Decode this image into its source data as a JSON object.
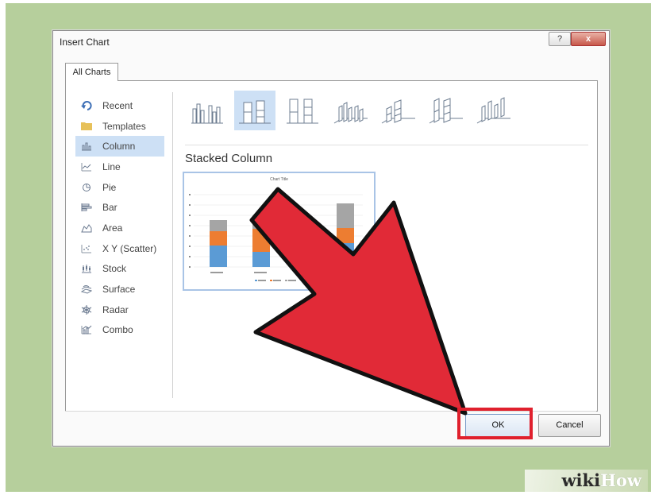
{
  "dialog": {
    "title": "Insert Chart",
    "help_label": "?",
    "close_label": "x",
    "tab_label": "All Charts"
  },
  "sidebar": {
    "items": [
      {
        "label": "Recent",
        "icon": "recent-icon",
        "selected": false
      },
      {
        "label": "Templates",
        "icon": "folder-icon",
        "selected": false
      },
      {
        "label": "Column",
        "icon": "column-chart-icon",
        "selected": true
      },
      {
        "label": "Line",
        "icon": "line-chart-icon",
        "selected": false
      },
      {
        "label": "Pie",
        "icon": "pie-chart-icon",
        "selected": false
      },
      {
        "label": "Bar",
        "icon": "bar-chart-icon",
        "selected": false
      },
      {
        "label": "Area",
        "icon": "area-chart-icon",
        "selected": false
      },
      {
        "label": "X Y (Scatter)",
        "icon": "scatter-chart-icon",
        "selected": false
      },
      {
        "label": "Stock",
        "icon": "stock-chart-icon",
        "selected": false
      },
      {
        "label": "Surface",
        "icon": "surface-chart-icon",
        "selected": false
      },
      {
        "label": "Radar",
        "icon": "radar-chart-icon",
        "selected": false
      },
      {
        "label": "Combo",
        "icon": "combo-chart-icon",
        "selected": false
      }
    ]
  },
  "subtypes": {
    "selected_name": "Stacked Column",
    "icons": [
      "clustered-column-icon",
      "stacked-column-icon",
      "100-stacked-column-icon",
      "3d-clustered-column-icon",
      "3d-stacked-column-icon",
      "3d-100-stacked-column-icon",
      "3d-column-icon"
    ],
    "selected_index": 1
  },
  "preview": {
    "title": "Chart Title"
  },
  "buttons": {
    "ok": "OK",
    "cancel": "Cancel"
  },
  "watermark": {
    "part1": "wiki",
    "part2": "How"
  },
  "colors": {
    "background": "#b6cf9c",
    "selection": "#cde0f5",
    "annotation_red": "#e0202d",
    "series1": "#5b9bd5",
    "series2": "#ed7d31",
    "series3": "#a5a5a5"
  }
}
